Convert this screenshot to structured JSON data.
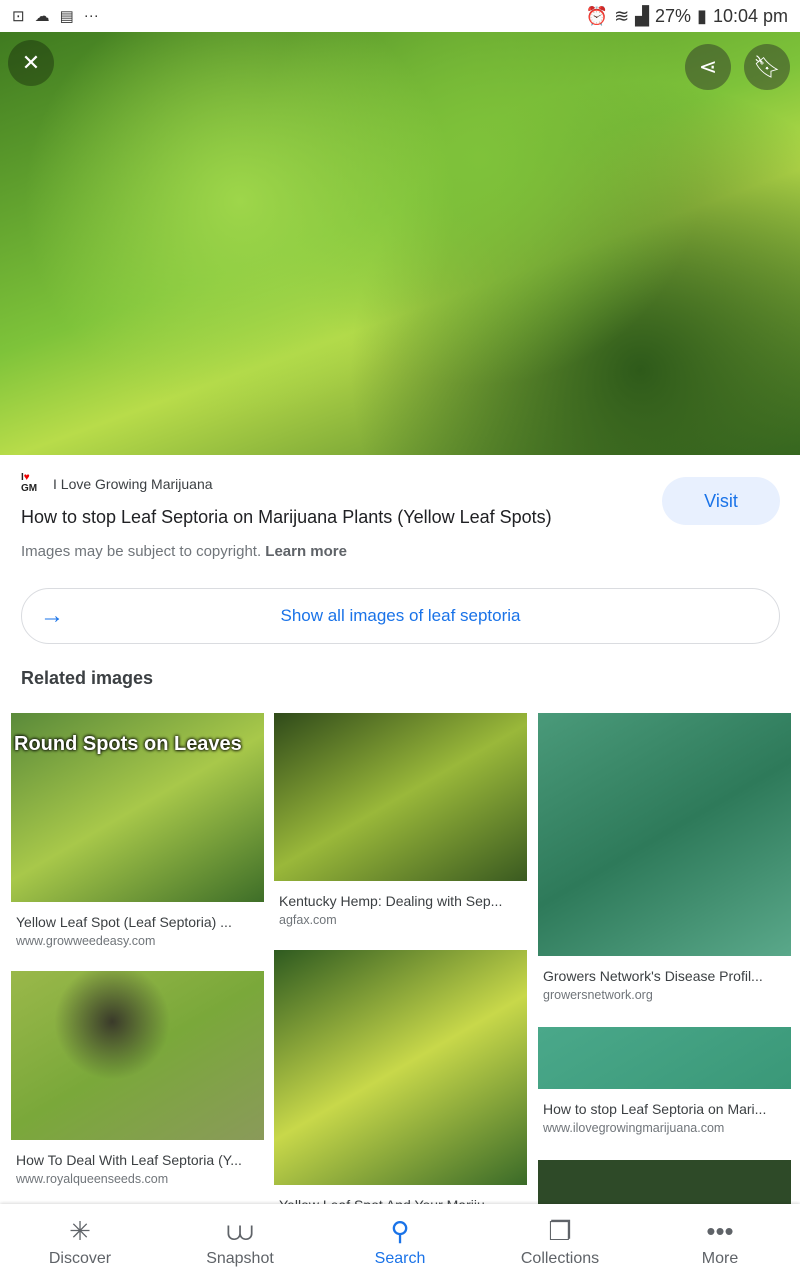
{
  "status": {
    "battery": "27%",
    "time": "10:04 pm"
  },
  "result": {
    "source": "I Love Growing Marijuana",
    "logo": "I ♥ GM",
    "visit": "Visit",
    "title": "How to stop Leaf Septoria on Marijuana Plants (Yellow Leaf Spots)",
    "copyright": "Images may be subject to copyright.",
    "learn_more": "Learn more",
    "show_all": "Show all images of leaf septoria"
  },
  "related": {
    "heading": "Related images",
    "items": [
      {
        "title": "Yellow Leaf Spot (Leaf Septoria) ...",
        "site": "www.growweedeasy.com",
        "overlay": "Round Spots on Leaves"
      },
      {
        "title": "Kentucky Hemp: Dealing with Sep...",
        "site": "agfax.com"
      },
      {
        "title": "Growers Network's Disease Profil...",
        "site": "growersnetwork.org"
      },
      {
        "title": "How To Deal With Leaf Septoria (Y...",
        "site": "www.royalqueenseeds.com"
      },
      {
        "title": "Yellow Leaf Spot And Your Mariju...",
        "site": ""
      },
      {
        "title": "How to stop Leaf Septoria on Mari...",
        "site": "www.ilovegrowingmarijuana.com"
      }
    ]
  },
  "nav": [
    {
      "label": "Discover",
      "icon": "asterisk"
    },
    {
      "label": "Snapshot",
      "icon": "snapshot"
    },
    {
      "label": "Search",
      "icon": "search"
    },
    {
      "label": "Collections",
      "icon": "bookmarks"
    },
    {
      "label": "More",
      "icon": "more"
    }
  ]
}
